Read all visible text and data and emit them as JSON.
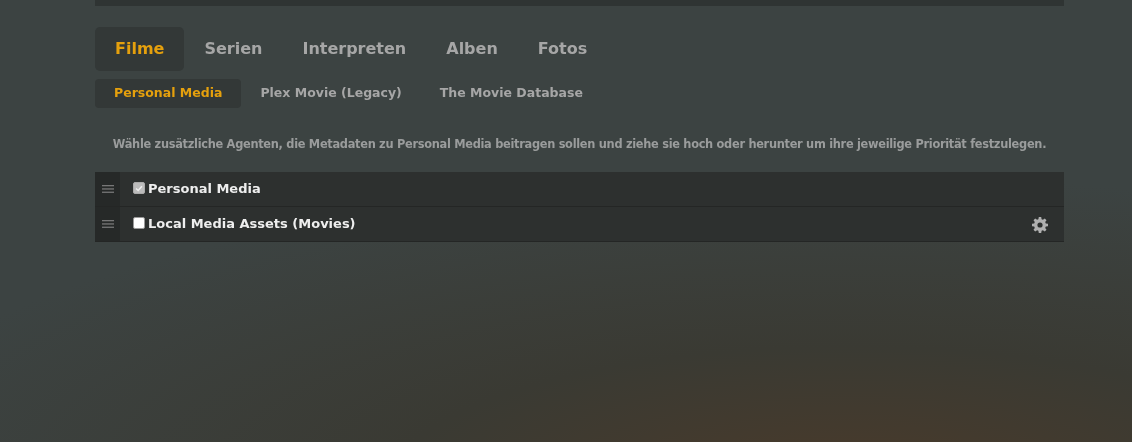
{
  "tabs": [
    {
      "label": "Filme",
      "selected": true
    },
    {
      "label": "Serien",
      "selected": false
    },
    {
      "label": "Interpreten",
      "selected": false
    },
    {
      "label": "Alben",
      "selected": false
    },
    {
      "label": "Fotos",
      "selected": false
    }
  ],
  "agent_tabs": [
    {
      "label": "Personal Media",
      "selected": true
    },
    {
      "label": "Plex Movie (Legacy)",
      "selected": false
    },
    {
      "label": "The Movie Database",
      "selected": false
    }
  ],
  "description": "Wähle zusätzliche Agenten, die Metadaten zu Personal Media beitragen sollen und ziehe sie hoch oder herunter um ihre jeweilige Priorität festzulegen.",
  "agents": [
    {
      "name": "Personal Media",
      "checked": true,
      "disabled": true,
      "settings": false
    },
    {
      "name": "Local Media Assets (Movies)",
      "checked": false,
      "disabled": false,
      "settings": true
    }
  ]
}
